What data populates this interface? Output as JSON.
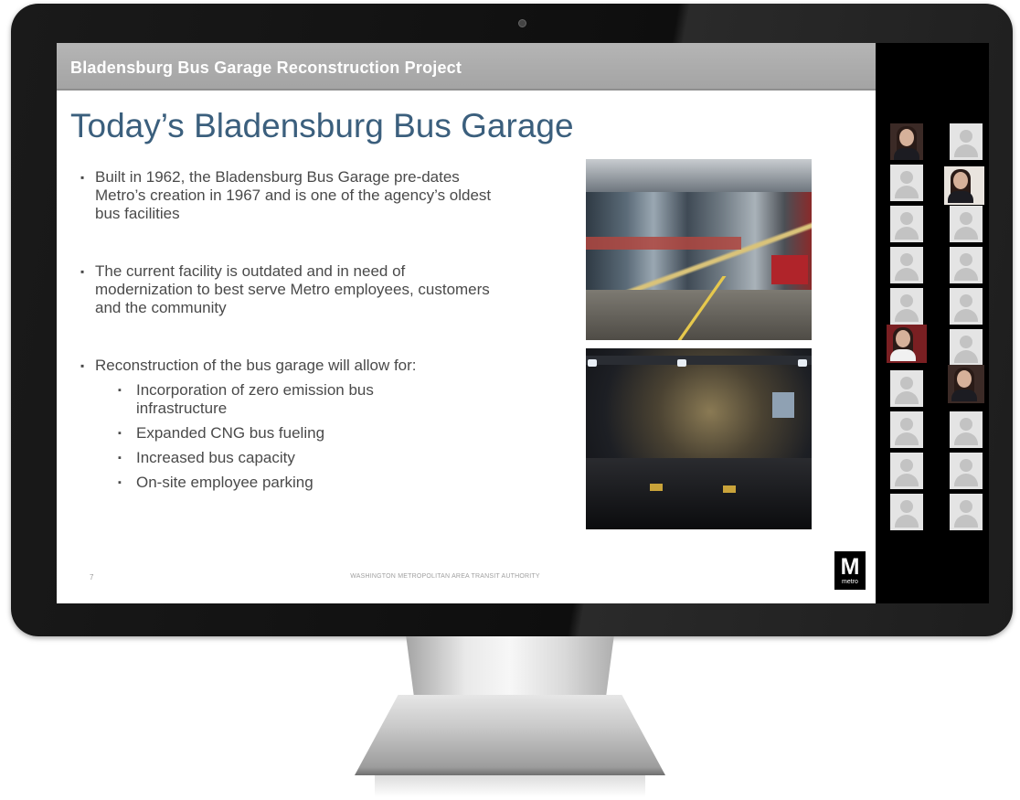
{
  "slide": {
    "header": "Bladensburg Bus Garage Reconstruction Project",
    "title": "Today’s Bladensburg Bus Garage",
    "bullets": [
      "Built in 1962, the Bladensburg Bus Garage pre-dates Metro’s creation in 1967 and is one of the agency’s oldest bus facilities",
      "The current facility is outdated and in need of modernization to best serve Metro employees, customers and the community",
      "Reconstruction of the bus garage will allow for:"
    ],
    "sub_bullets": [
      "Incorporation of zero emission bus infrastructure",
      "Expanded CNG bus fueling",
      "Increased bus capacity",
      "On-site employee parking"
    ],
    "footer_page_number": "7",
    "footer_text": "WASHINGTON METROPOLITAN AREA TRANSIT AUTHORITY",
    "logo": {
      "letter": "M",
      "word": "metro"
    }
  },
  "colors": {
    "header_bar": "#a9a9a9",
    "title": "#3b5f7d",
    "body_text": "#4a4a4a",
    "participant_panel": "#000000",
    "avatar_tile": "#e4e4e4"
  },
  "participants": {
    "tiles": [
      {
        "type": "video"
      },
      {
        "type": "avatar"
      },
      {
        "type": "avatar"
      },
      {
        "type": "video-light"
      },
      {
        "type": "avatar"
      },
      {
        "type": "avatar"
      },
      {
        "type": "avatar"
      },
      {
        "type": "avatar"
      },
      {
        "type": "avatar"
      },
      {
        "type": "avatar"
      },
      {
        "type": "video-red"
      },
      {
        "type": "avatar"
      },
      {
        "type": "avatar"
      },
      {
        "type": "video"
      },
      {
        "type": "avatar"
      },
      {
        "type": "avatar"
      },
      {
        "type": "avatar"
      },
      {
        "type": "avatar"
      },
      {
        "type": "avatar"
      },
      {
        "type": "avatar"
      }
    ]
  },
  "icons": {
    "webcam": "webcam-icon",
    "avatar_placeholder": "user-avatar-icon",
    "logo": "metro-logo-icon"
  }
}
